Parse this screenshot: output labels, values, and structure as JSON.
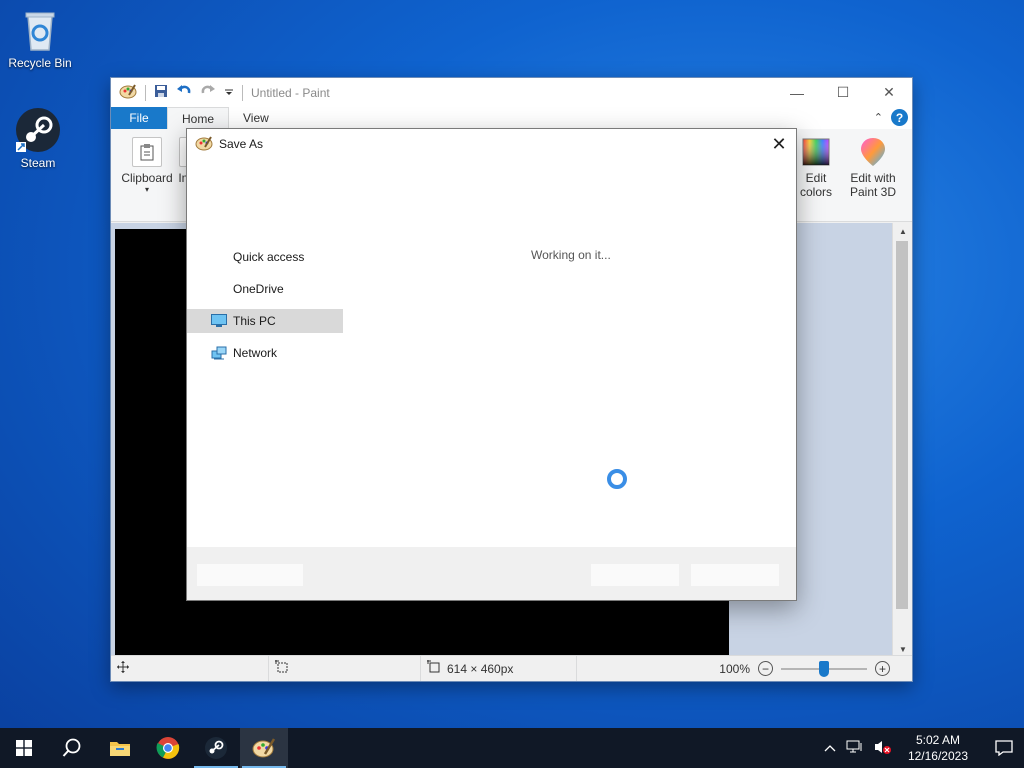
{
  "desktop": {
    "icons": [
      {
        "label": "Recycle Bin"
      },
      {
        "label": "Steam"
      }
    ]
  },
  "paint": {
    "title": "Untitled - Paint",
    "tabs": [
      {
        "label": "File"
      },
      {
        "label": "Home"
      },
      {
        "label": "View"
      }
    ],
    "ribbon": {
      "clipboard_label": "Clipboard",
      "image_label_partial": "Im",
      "edit_colors_line1": "Edit",
      "edit_colors_line2": "colors",
      "paint3d_line1": "Edit with",
      "paint3d_line2": "Paint 3D"
    },
    "status": {
      "size": "614 × 460px",
      "zoom": "100%"
    }
  },
  "dialog": {
    "title": "Save As",
    "nav": [
      {
        "label": "Quick access"
      },
      {
        "label": "OneDrive"
      },
      {
        "label": "This PC"
      },
      {
        "label": "Network"
      }
    ],
    "working_text": "Working on it..."
  },
  "taskbar": {
    "time": "5:02 AM",
    "date": "12/16/2023"
  },
  "colors": {
    "accent": "#1979ca",
    "taskbar": "#101826"
  }
}
